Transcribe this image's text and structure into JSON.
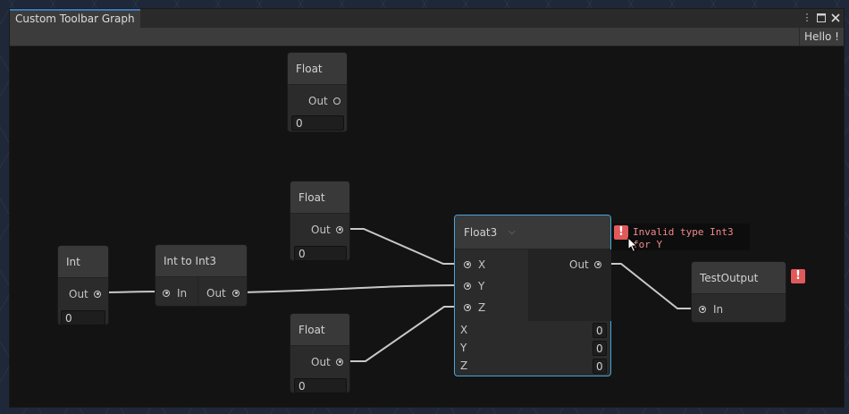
{
  "window": {
    "tab_title": "Custom Toolbar Graph",
    "controls": [
      "kebab-menu-icon",
      "maximize-icon",
      "close-icon"
    ]
  },
  "toolbar": {
    "hello_label": "Hello !"
  },
  "nodes": {
    "float_top": {
      "title": "Float",
      "out_label": "Out",
      "value": "0"
    },
    "float_mid": {
      "title": "Float",
      "out_label": "Out",
      "value": "0"
    },
    "float_bottom": {
      "title": "Float",
      "out_label": "Out",
      "value": "0"
    },
    "int_node": {
      "title": "Int",
      "out_label": "Out",
      "value": "0"
    },
    "int_to_int3": {
      "title": "Int to Int3",
      "in_label": "In",
      "out_label": "Out"
    },
    "float3": {
      "title": "Float3",
      "inputs": [
        "X",
        "Y",
        "Z"
      ],
      "out_label": "Out",
      "fields": [
        {
          "label": "X",
          "value": "0"
        },
        {
          "label": "Y",
          "value": "0"
        },
        {
          "label": "Z",
          "value": "0"
        }
      ]
    },
    "test_output": {
      "title": "TestOutput",
      "in_label": "In"
    }
  },
  "error": {
    "message": "Invalid type Int3 for Y"
  },
  "colors": {
    "accent": "#3a79bb",
    "selection": "#44a7de",
    "error": "#e05a5a",
    "canvas": "#131313"
  }
}
